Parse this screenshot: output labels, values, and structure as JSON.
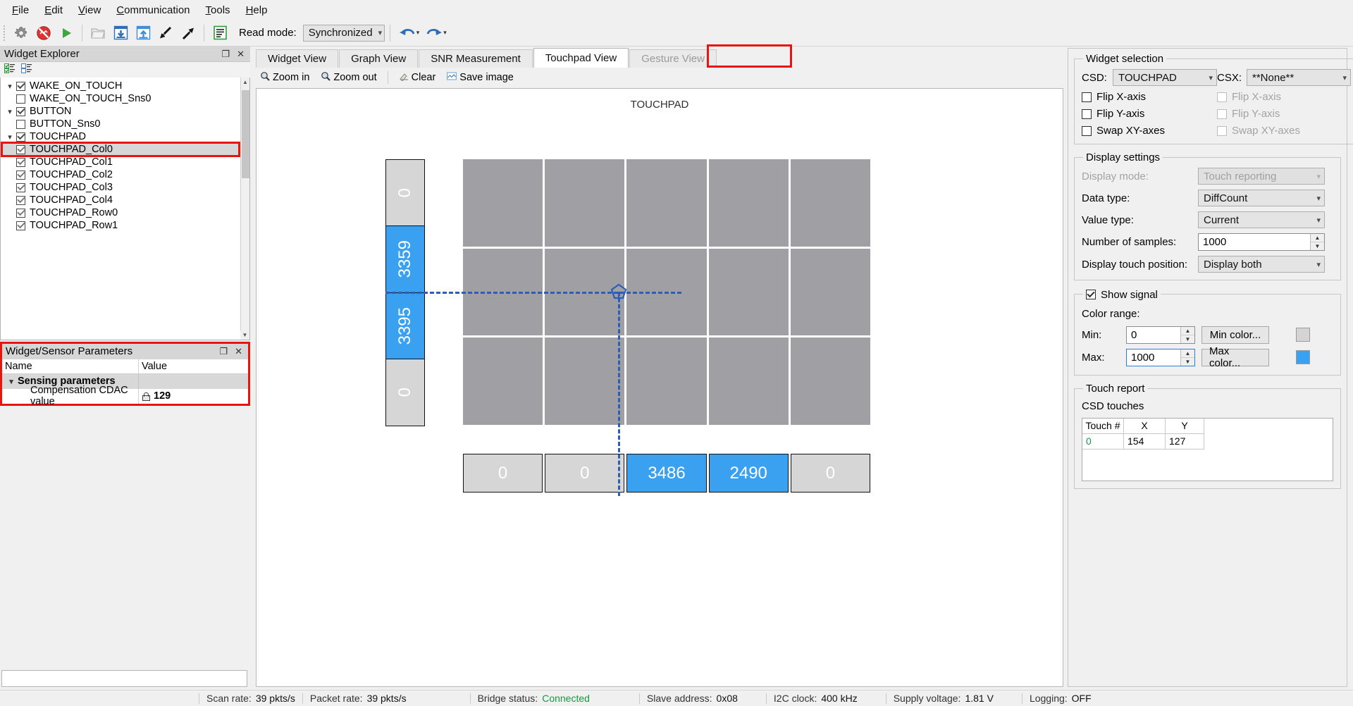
{
  "menubar": [
    {
      "label": "File",
      "mnemonic": "F"
    },
    {
      "label": "Edit",
      "mnemonic": "E"
    },
    {
      "label": "View",
      "mnemonic": "V"
    },
    {
      "label": "Communication",
      "mnemonic": "C"
    },
    {
      "label": "Tools",
      "mnemonic": "T"
    },
    {
      "label": "Help",
      "mnemonic": "H"
    }
  ],
  "toolbar": {
    "read_mode_label": "Read mode:",
    "read_mode_value": "Synchronized",
    "icons": [
      "gear-icon",
      "disconnect-icon",
      "start-icon",
      "open-folder-icon",
      "download-icon",
      "upload-icon",
      "import-icon",
      "export-icon",
      "log-icon",
      "undo-icon",
      "redo-icon"
    ]
  },
  "widget_explorer": {
    "title": "Widget Explorer",
    "tree": [
      {
        "label": "WAKE_ON_TOUCH",
        "level": 0,
        "checked": true,
        "expander": "v",
        "selected": false
      },
      {
        "label": "WAKE_ON_TOUCH_Sns0",
        "level": 1,
        "checked": false,
        "expander": "",
        "selected": false
      },
      {
        "label": "BUTTON",
        "level": 0,
        "checked": true,
        "expander": "v",
        "selected": false
      },
      {
        "label": "BUTTON_Sns0",
        "level": 1,
        "checked": false,
        "expander": "",
        "selected": false
      },
      {
        "label": "TOUCHPAD",
        "level": 0,
        "checked": true,
        "expander": "v",
        "selected": false
      },
      {
        "label": "TOUCHPAD_Col0",
        "level": 1,
        "checked": true,
        "expander": "",
        "selected": true
      },
      {
        "label": "TOUCHPAD_Col1",
        "level": 1,
        "checked": true,
        "expander": "",
        "selected": false
      },
      {
        "label": "TOUCHPAD_Col2",
        "level": 1,
        "checked": true,
        "expander": "",
        "selected": false
      },
      {
        "label": "TOUCHPAD_Col3",
        "level": 1,
        "checked": true,
        "expander": "",
        "selected": false
      },
      {
        "label": "TOUCHPAD_Col4",
        "level": 1,
        "checked": true,
        "expander": "",
        "selected": false
      },
      {
        "label": "TOUCHPAD_Row0",
        "level": 1,
        "checked": true,
        "expander": "",
        "selected": false
      },
      {
        "label": "TOUCHPAD_Row1",
        "level": 1,
        "checked": true,
        "expander": "",
        "selected": false
      }
    ]
  },
  "parameters": {
    "title": "Widget/Sensor Parameters",
    "col_name": "Name",
    "col_value": "Value",
    "group_label": "Sensing parameters",
    "rows": [
      {
        "name": "Compensation CDAC value",
        "value": "129",
        "locked": true
      }
    ]
  },
  "tabs": [
    {
      "label": "Widget View",
      "active": false,
      "disabled": false
    },
    {
      "label": "Graph View",
      "active": false,
      "disabled": false
    },
    {
      "label": "SNR Measurement",
      "active": false,
      "disabled": false
    },
    {
      "label": "Touchpad View",
      "active": true,
      "disabled": false
    },
    {
      "label": "Gesture View",
      "active": false,
      "disabled": true
    }
  ],
  "view_toolbar": [
    {
      "label": "Zoom in",
      "icon": "zoom-in-icon"
    },
    {
      "label": "Zoom out",
      "icon": "zoom-out-icon"
    },
    {
      "label": "Clear",
      "icon": "clear-icon"
    },
    {
      "label": "Save image",
      "icon": "save-image-icon"
    }
  ],
  "touchpad": {
    "title": "TOUCHPAD",
    "rows": [
      "0",
      "3359",
      "3395",
      "0"
    ],
    "row_active": [
      false,
      true,
      true,
      false
    ],
    "cols": [
      "0",
      "0",
      "3486",
      "2490",
      "0"
    ],
    "col_active": [
      false,
      false,
      true,
      true,
      false
    ]
  },
  "widget_selection": {
    "legend": "Widget selection",
    "csd_label": "CSD:",
    "csd_value": "TOUCHPAD",
    "csx_label": "CSX:",
    "csx_value": "**None**",
    "csd_options": [
      {
        "label": "Flip X-axis",
        "checked": false,
        "disabled": false
      },
      {
        "label": "Flip Y-axis",
        "checked": false,
        "disabled": false
      },
      {
        "label": "Swap XY-axes",
        "checked": false,
        "disabled": false
      }
    ],
    "csx_options": [
      {
        "label": "Flip X-axis",
        "checked": false,
        "disabled": true
      },
      {
        "label": "Flip Y-axis",
        "checked": false,
        "disabled": true
      },
      {
        "label": "Swap XY-axes",
        "checked": false,
        "disabled": true
      }
    ]
  },
  "display_settings": {
    "legend": "Display settings",
    "fields": [
      {
        "label": "Display mode:",
        "value": "Touch reporting",
        "type": "combo",
        "disabled": true
      },
      {
        "label": "Data type:",
        "value": "DiffCount",
        "type": "combo",
        "disabled": false
      },
      {
        "label": "Value type:",
        "value": "Current",
        "type": "combo",
        "disabled": false
      },
      {
        "label": "Number of samples:",
        "value": "1000",
        "type": "spin",
        "disabled": false
      },
      {
        "label": "Display touch position:",
        "value": "Display both",
        "type": "combo",
        "disabled": false
      }
    ]
  },
  "show_signal": {
    "legend": "Show signal",
    "checked": true,
    "color_range_label": "Color range:",
    "min_label": "Min:",
    "min_value": "0",
    "min_button": "Min color...",
    "min_color": "#d4d4d4",
    "max_label": "Max:",
    "max_value": "1000",
    "max_button": "Max color...",
    "max_color": "#3aa0f0"
  },
  "touch_report": {
    "legend": "Touch report",
    "subtitle": "CSD touches",
    "headers": [
      "Touch #",
      "X",
      "Y"
    ],
    "rows": [
      [
        "0",
        "154",
        "127"
      ]
    ]
  },
  "statusbar": [
    {
      "key": "Scan rate:",
      "value": "39 pkts/s"
    },
    {
      "key": "Packet rate:",
      "value": "39 pkts/s"
    },
    {
      "key": "Bridge status:",
      "value": "Connected",
      "value_color": "#149a3f"
    },
    {
      "key": "Slave address:",
      "value": "0x08"
    },
    {
      "key": "I2C clock:",
      "value": "400 kHz"
    },
    {
      "key": "Supply voltage:",
      "value": "1.81 V"
    },
    {
      "key": "Logging:",
      "value": "OFF"
    }
  ]
}
